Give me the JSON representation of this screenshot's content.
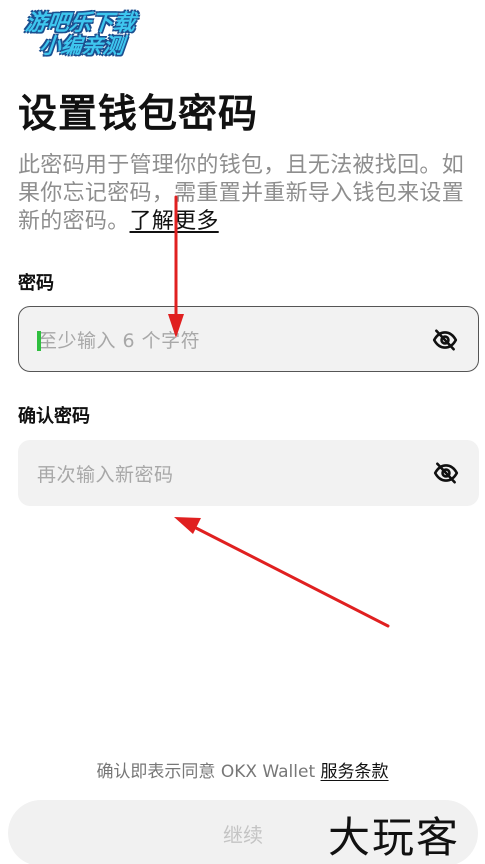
{
  "watermark": {
    "line1": "游吧乐下载",
    "line2": "小编亲测"
  },
  "page": {
    "title": "设置钱包密码",
    "description": "此密码用于管理你的钱包，且无法被找回。如果你忘记密码，需重置并重新导入钱包来设置新的密码。",
    "learn_more": "了解更多"
  },
  "password": {
    "label": "密码",
    "placeholder": "至少输入 6 个字符"
  },
  "confirm": {
    "label": "确认密码",
    "placeholder": "再次输入新密码"
  },
  "agreement": {
    "prefix": "确认即表示同意 OKX Wallet ",
    "terms": "服务条款"
  },
  "continue_label": "继续",
  "brand_mark": "大玩客",
  "colors": {
    "caret": "#2fbf3f",
    "arrow": "#e02020",
    "watermark": "#3ec6ee"
  },
  "icons": {
    "visibility": "eye-off-icon"
  }
}
